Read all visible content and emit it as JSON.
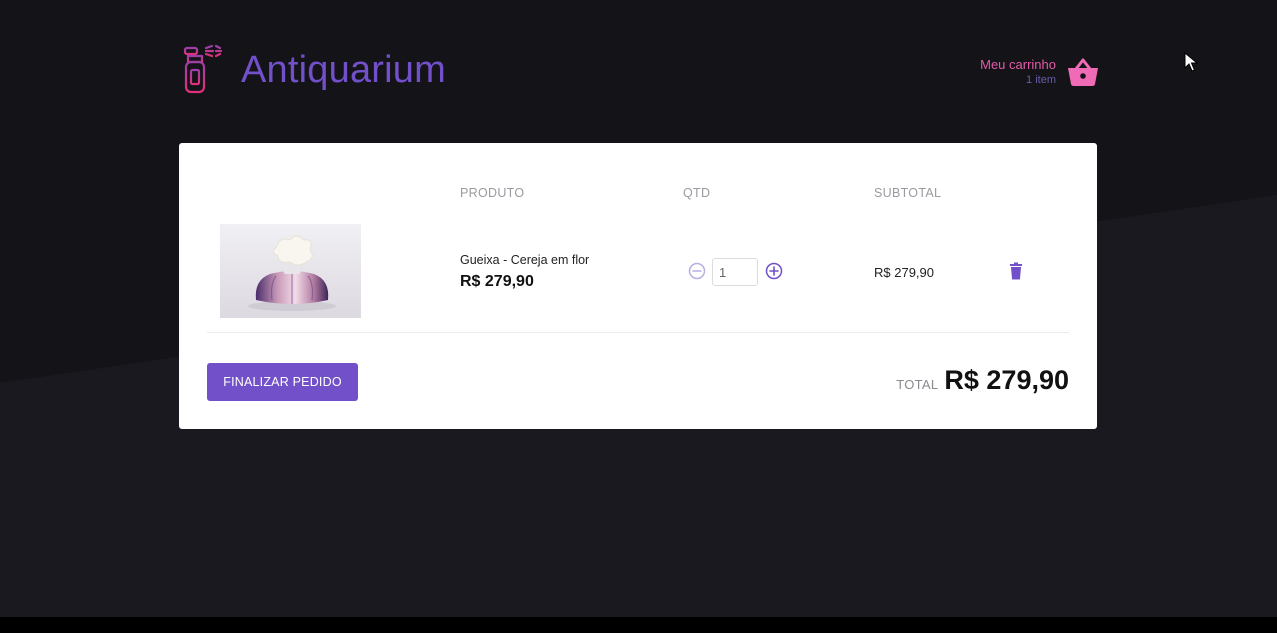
{
  "header": {
    "title": "Antiquarium",
    "cart": {
      "label": "Meu carrinho",
      "count": "1 item"
    }
  },
  "cart_table": {
    "columns": [
      "PRODUTO",
      "QTD",
      "SUBTOTAL"
    ],
    "items": [
      {
        "name": "Gueixa - Cereja em flor",
        "price": "R$ 279,90",
        "quantity": "1",
        "subtotal": "R$ 279,90"
      }
    ]
  },
  "footer": {
    "checkout_label": "FINALIZAR PEDIDO",
    "total_label": "TOTAL",
    "total_value": "R$ 279,90"
  },
  "colors": {
    "accent": "#7150c9",
    "pink": "#e35ba8",
    "background": "#131318",
    "card": "#ffffff"
  },
  "icons": [
    "perfume-bottle-icon",
    "shopping-basket-icon",
    "minus-circle-icon",
    "plus-circle-icon",
    "trash-icon",
    "mouse-cursor-icon"
  ]
}
